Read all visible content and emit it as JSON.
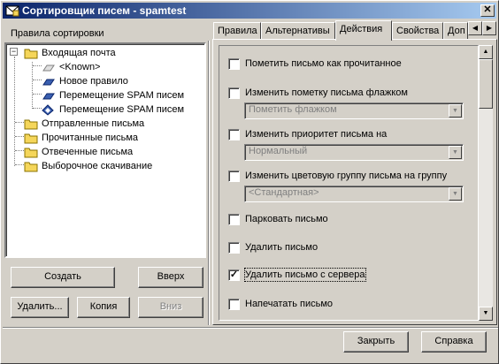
{
  "window": {
    "title": "Сортировщик писем - spamtest",
    "close_glyph": "✕"
  },
  "left": {
    "label": "Правила сортировки",
    "tree": [
      {
        "label": "Входящая почта",
        "icon": "folder-icon",
        "expander": "−"
      },
      {
        "label": "<Known>",
        "icon": "rule-disabled-icon"
      },
      {
        "label": "Новое правило",
        "icon": "rule-icon"
      },
      {
        "label": "Перемещение SPAM писем",
        "icon": "rule-icon"
      },
      {
        "label": "Перемещение SPAM писем",
        "icon": "rule-diamond-icon"
      },
      {
        "label": "Отправленные письма",
        "icon": "folder-icon"
      },
      {
        "label": "Прочитанные письма",
        "icon": "folder-icon"
      },
      {
        "label": "Отвеченные письма",
        "icon": "folder-icon"
      },
      {
        "label": "Выборочное скачивание",
        "icon": "folder-icon"
      }
    ],
    "buttons": {
      "create": "Создать",
      "up": "Вверх",
      "delete": "Удалить...",
      "copy": "Копия",
      "down": "Вниз"
    }
  },
  "tabs": [
    "Правила",
    "Альтернативы",
    "Действия",
    "Свойства",
    "Доп"
  ],
  "active_tab": "Действия",
  "actions": [
    {
      "label": "Пометить письмо как прочитанное",
      "checked": false
    },
    {
      "label": "Изменить пометку письма флажком",
      "checked": false,
      "combo": "Пометить флажком"
    },
    {
      "label": "Изменить приоритет письма на",
      "checked": false,
      "combo": "Нормальный"
    },
    {
      "label": "Изменить цветовую группу письма на группу",
      "checked": false,
      "combo": "<Стандартная>"
    },
    {
      "label": "Парковать письмо",
      "checked": false
    },
    {
      "label": "Удалить письмо",
      "checked": false
    },
    {
      "label": "Удалить письмо с сервера",
      "checked": true
    },
    {
      "label": "Напечатать письмо",
      "checked": false
    }
  ],
  "footer": {
    "close": "Закрыть",
    "help": "Справка"
  },
  "colors": {
    "title_start": "#0a246a",
    "title_end": "#a6caf0",
    "face": "#d4d0c8",
    "folder": "#f5d65a"
  }
}
